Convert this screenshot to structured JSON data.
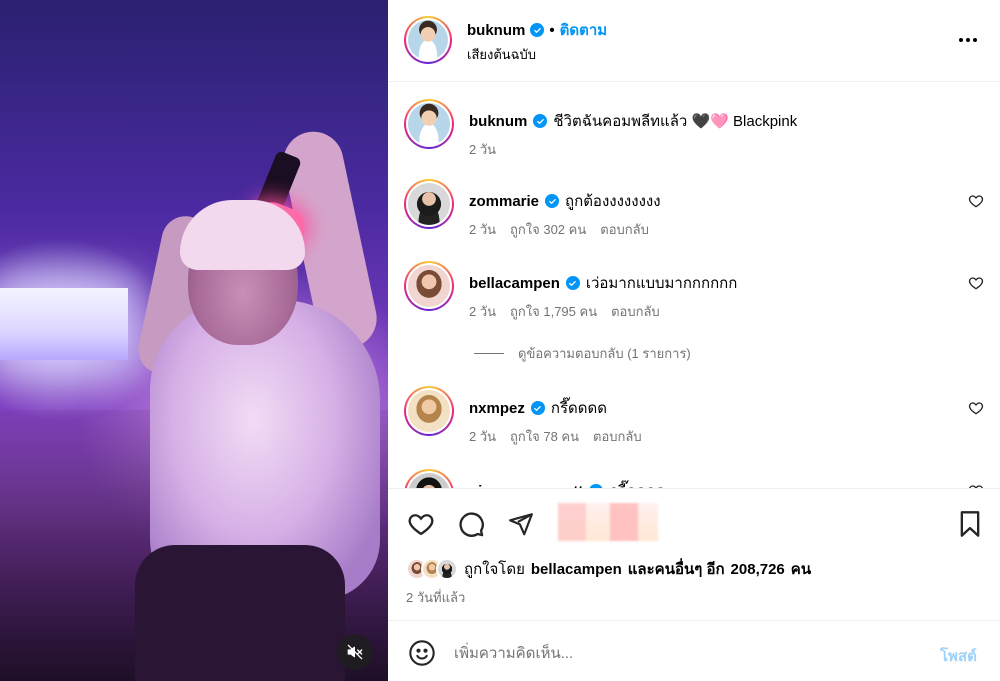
{
  "post": {
    "author": "buknum",
    "follow_label": "ติดตาม",
    "separator": "•",
    "audio_label": "เสียงต้นฉบับ",
    "more_icon": "more-horizontal-icon"
  },
  "caption": {
    "username": "buknum",
    "text": "ชีวิตฉันคอมพลีทแล้ว 🖤🩷 Blackpink",
    "time": "2 วัน"
  },
  "comments": [
    {
      "username": "zommarie",
      "text": "ถูกต้องงงงงงงง",
      "time": "2 วัน",
      "likes": "ถูกใจ 302 คน",
      "reply": "ตอบกลับ"
    },
    {
      "username": "bellacampen",
      "text": "เว่อมากแบบมากกกกกก",
      "time": "2 วัน",
      "likes": "ถูกใจ 1,795 คน",
      "reply": "ตอบกลับ"
    },
    {
      "username": "nxmpez",
      "text": "กรี๊ดดดด",
      "time": "2 วัน",
      "likes": "ถูกใจ 78 คน",
      "reply": "ตอบกลับ"
    },
    {
      "username": "nisamanee_nutt",
      "text": "กรี๊ดดดด",
      "time": "",
      "likes": "",
      "reply": ""
    }
  ],
  "view_replies": "ดูข้อความตอบกลับ (1 รายการ)",
  "actions": {
    "like_icon": "heart-icon",
    "comment_icon": "comment-icon",
    "share_icon": "paper-plane-icon",
    "save_icon": "bookmark-icon"
  },
  "likes": {
    "prefix": "ถูกใจโดย",
    "user": "bellacampen",
    "middle": "และคนอื่นๆ อีก",
    "count": "208,726",
    "suffix": "คน"
  },
  "posted_ago": "2 วันที่แล้ว",
  "composer": {
    "placeholder": "เพิ่มความคิดเห็น...",
    "post_label": "โพสต์"
  },
  "colors": {
    "accent": "#0095f6",
    "muted": "#737373",
    "post_disabled": "#9fd2f9"
  }
}
